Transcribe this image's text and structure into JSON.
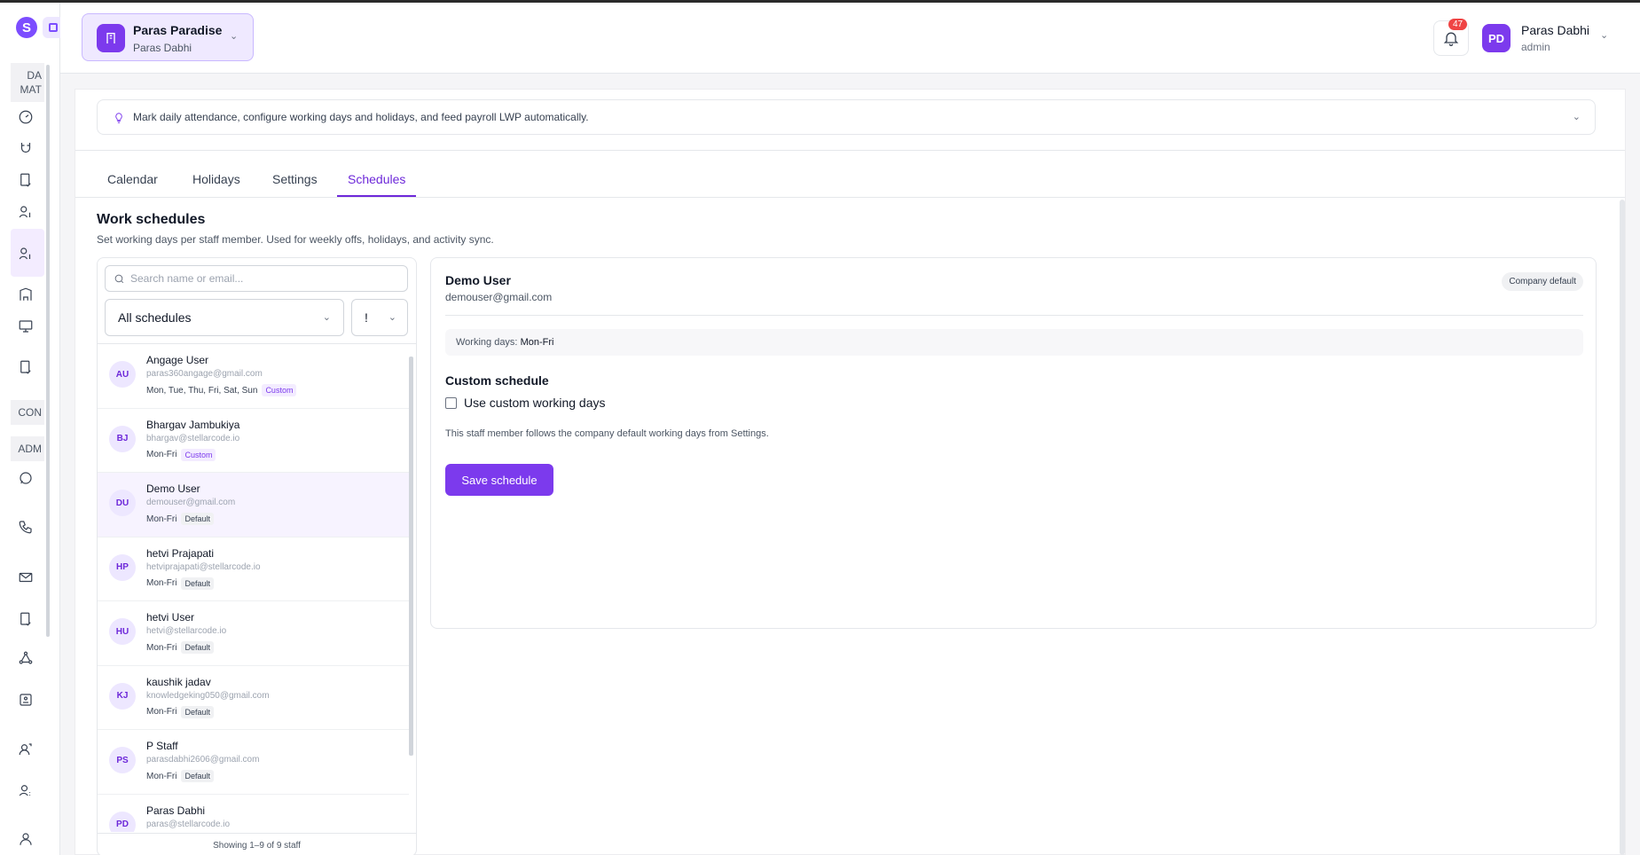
{
  "sidebar": {
    "logo_letter": "S",
    "sections": [
      "DA MAT",
      "CON",
      "ADM"
    ],
    "icons": [
      "dashboard-icon",
      "magnet-icon",
      "document-check-icon",
      "user-dollar-icon",
      "user-dollar-active-icon",
      "building-icon",
      "presentation-icon",
      "file-check-icon",
      "whatsapp-icon",
      "phone-incoming-icon",
      "mail-icon",
      "invoice-icon",
      "network-icon",
      "contact-card-icon",
      "user-growth-icon",
      "user-question-icon",
      "profile-icon"
    ]
  },
  "header": {
    "org_name": "Paras Paradise",
    "org_sub": "Paras Dabhi",
    "notification_count": "47",
    "user_initials": "PD",
    "user_name": "Paras Dabhi",
    "user_role": "admin"
  },
  "info_banner": {
    "text": "Mark daily attendance, configure working days and holidays, and feed payroll LWP automatically."
  },
  "tabs": [
    {
      "label": "Calendar"
    },
    {
      "label": "Holidays"
    },
    {
      "label": "Settings"
    },
    {
      "label": "Schedules"
    }
  ],
  "work_schedules": {
    "title": "Work schedules",
    "subtitle": "Set working days per staff member. Used for weekly offs, holidays, and activity sync."
  },
  "list_panel": {
    "search_placeholder": "Search name or email...",
    "filter_selected": "All schedules",
    "second_filter": "!",
    "footer": "Showing 1–9 of 9 staff",
    "staff": [
      {
        "initials": "AU",
        "name": "Angage User",
        "email": "paras360angage@gmail.com",
        "days": "Mon, Tue, Thu, Fri, Sat, Sun",
        "badge": "Custom"
      },
      {
        "initials": "BJ",
        "name": "Bhargav Jambukiya",
        "email": "bhargav@stellarcode.io",
        "days": "Mon-Fri",
        "badge": "Custom"
      },
      {
        "initials": "DU",
        "name": "Demo User",
        "email": "demouser@gmail.com",
        "days": "Mon-Fri",
        "badge": "Default"
      },
      {
        "initials": "HP",
        "name": "hetvi Prajapati",
        "email": "hetviprajapati@stellarcode.io",
        "days": "Mon-Fri",
        "badge": "Default"
      },
      {
        "initials": "HU",
        "name": "hetvi User",
        "email": "hetvi@stellarcode.io",
        "days": "Mon-Fri",
        "badge": "Default"
      },
      {
        "initials": "KJ",
        "name": "kaushik jadav",
        "email": "knowledgeking050@gmail.com",
        "days": "Mon-Fri",
        "badge": "Default"
      },
      {
        "initials": "PS",
        "name": "P Staff",
        "email": "parasdabhi2606@gmail.com",
        "days": "Mon-Fri",
        "badge": "Default"
      },
      {
        "initials": "PD",
        "name": "Paras Dabhi",
        "email": "paras@stellarcode.io",
        "days": "",
        "badge": ""
      }
    ]
  },
  "detail": {
    "name": "Demo User",
    "email": "demouser@gmail.com",
    "badge": "Company default",
    "working_days_label": "Working days:",
    "working_days_value": "Mon-Fri",
    "custom_title": "Custom schedule",
    "checkbox_label": "Use custom working days",
    "note": "This staff member follows the company default working days from Settings.",
    "save_label": "Save schedule"
  }
}
